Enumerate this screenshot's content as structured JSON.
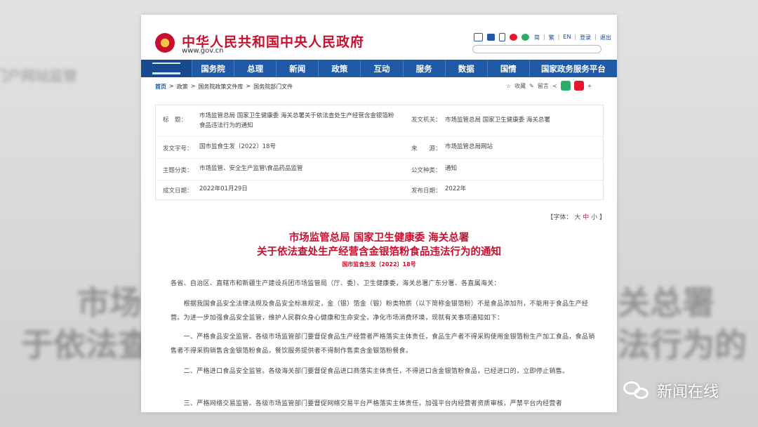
{
  "background": {
    "left_top": "门户网站监管",
    "left_line1": "市场",
    "left_line2": "于依法查",
    "right_line1": "关总署",
    "right_line2": "法行为的"
  },
  "header": {
    "title": "中华人民共和国中央人民政府",
    "url": "www.gov.cn",
    "links": [
      "简",
      "繁",
      "EN",
      "登录",
      "退出"
    ],
    "colors": {
      "brand_red": "#c8102e",
      "nav_blue": "#1f5aa8"
    }
  },
  "nav": {
    "items": [
      "国务院",
      "总理",
      "新闻",
      "政策",
      "互动",
      "服务",
      "数据",
      "国情",
      "国家政务服务平台"
    ]
  },
  "breadcrumb": {
    "items": [
      "首页",
      "政策",
      "国务院政策文件库",
      "国务院部门文件"
    ]
  },
  "share": {
    "favorite": "收藏",
    "print": "留言"
  },
  "info": {
    "title_label": "标　题：",
    "title_value": "市场监管总局 国家卫生健康委 海关总署关于依法查处生产经营含金银箔粉食品违法行为的通知",
    "issuer_label": "发文机关：",
    "issuer_value": "市场监管总局 国家卫生健康委 海关总署",
    "doc_no_label": "发文字号：",
    "doc_no_value": "国市监食生发〔2022〕18号",
    "source_label": "来　　源：",
    "source_value": "市场监管总局网站",
    "category_label": "主题分类：",
    "category_value": "市场监管、安全生产监管\\食品药品监管",
    "type_label": "公文种类：",
    "type_value": "通知",
    "written_label": "成文日期：",
    "written_value": "2022年01月29日",
    "published_label": "发布日期：",
    "published_value": "2022年"
  },
  "font_size": {
    "prefix": "【字体：",
    "large": "大",
    "medium": "中",
    "small": "小",
    "suffix": "】"
  },
  "article": {
    "title_line1": "市场监管总局 国家卫生健康委 海关总署",
    "title_line2": "关于依法查处生产经营含金银箔粉食品违法行为的通知",
    "doc_no": "国市监食生发〔2022〕18号",
    "para1": "各省、自治区、直辖市和新疆生产建设兵团市场监管局（厅、委）、卫生健康委，海关总署广东分署、各直属海关：",
    "para2": "　　根据我国食品安全法律法规及食品安全标准规定，金（银）箔金（银）粉类物质（以下简称金银箔粉）不是食品添加剂，不能用于食品生产经营。为进一步加强食品安全监管，维护人民群众身心健康和生命安全，净化市场消费环境，现就有关事项通知如下：",
    "para3": "　　一、严格食品安全监管。各级市场监管部门要督促食品生产经营者严格落实主体责任，食品生产者不得采购使用金银箔粉生产加工食品，食品销售者不得采购销售含金银箔粉食品，餐饮服务提供者不得制作售卖含金银箔粉餐食。",
    "para4": "　　二、严格进口食品安全监管。各级海关部门要督促食品进口商落实主体责任，不得进口含金银箔粉食品，已经进口的，立即停止销售。",
    "para5": "　　三、严格网络交易监管。各级市场监管部门要督促网络交易平台严格落实主体责任，加强平台内经营者资质审核，严禁平台内经营者"
  },
  "watermark": {
    "text": "新闻在线",
    "icon": "wechat-icon"
  }
}
